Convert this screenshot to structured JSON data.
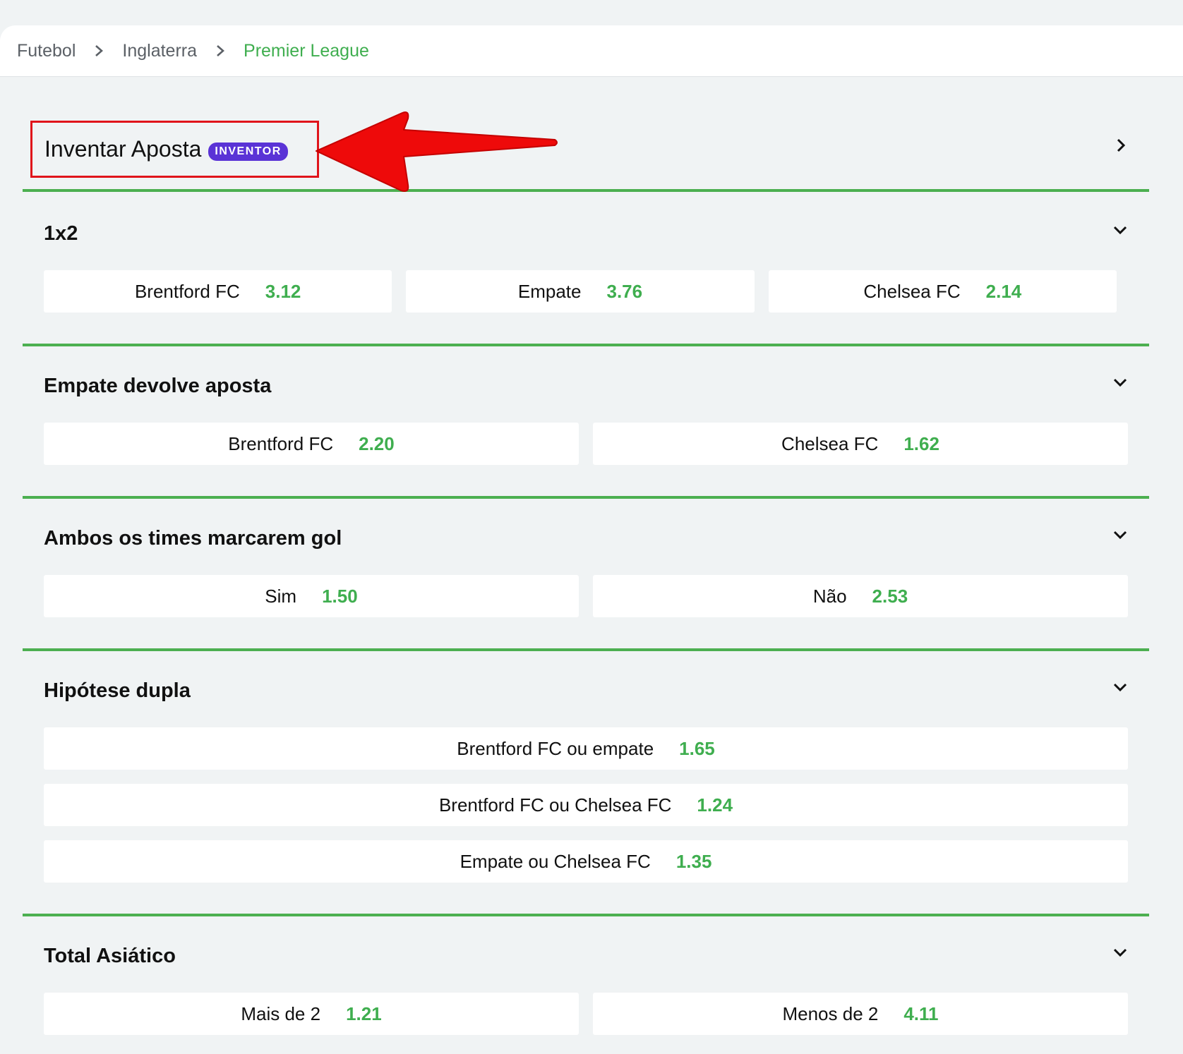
{
  "breadcrumb": {
    "items": [
      {
        "label": "Futebol"
      },
      {
        "label": "Inglaterra"
      },
      {
        "label": "Premier League"
      }
    ]
  },
  "inventor": {
    "title": "Inventar Aposta",
    "badge": "INVENTOR"
  },
  "markets": {
    "m1x2": {
      "title": "1x2",
      "options": [
        {
          "label": "Brentford FC",
          "odd": "3.12"
        },
        {
          "label": "Empate",
          "odd": "3.76"
        },
        {
          "label": "Chelsea FC",
          "odd": "2.14"
        }
      ]
    },
    "draw_no_bet": {
      "title": "Empate devolve aposta",
      "options": [
        {
          "label": "Brentford FC",
          "odd": "2.20"
        },
        {
          "label": "Chelsea FC",
          "odd": "1.62"
        }
      ]
    },
    "btts": {
      "title": "Ambos os times marcarem gol",
      "options": [
        {
          "label": "Sim",
          "odd": "1.50"
        },
        {
          "label": "Não",
          "odd": "2.53"
        }
      ]
    },
    "double_chance": {
      "title": "Hipótese dupla",
      "options": [
        {
          "label": "Brentford FC ou empate",
          "odd": "1.65"
        },
        {
          "label": "Brentford FC ou Chelsea FC",
          "odd": "1.24"
        },
        {
          "label": "Empate ou Chelsea FC",
          "odd": "1.35"
        }
      ]
    },
    "asian_total": {
      "title": "Total Asiático",
      "options": [
        {
          "label": "Mais de 2",
          "odd": "1.21"
        },
        {
          "label": "Menos de 2",
          "odd": "4.11"
        }
      ]
    }
  },
  "colors": {
    "accent_green": "#3fae4f",
    "divider_green": "#4caf50",
    "badge_purple": "#5a33d6",
    "highlight_red": "#e0141b"
  },
  "icons": {
    "breadcrumb_separator": "chevron-right-icon",
    "inventor_open": "chevron-right-icon",
    "market_toggle": "chevron-down-icon",
    "annotation": "arrow-left-icon"
  }
}
